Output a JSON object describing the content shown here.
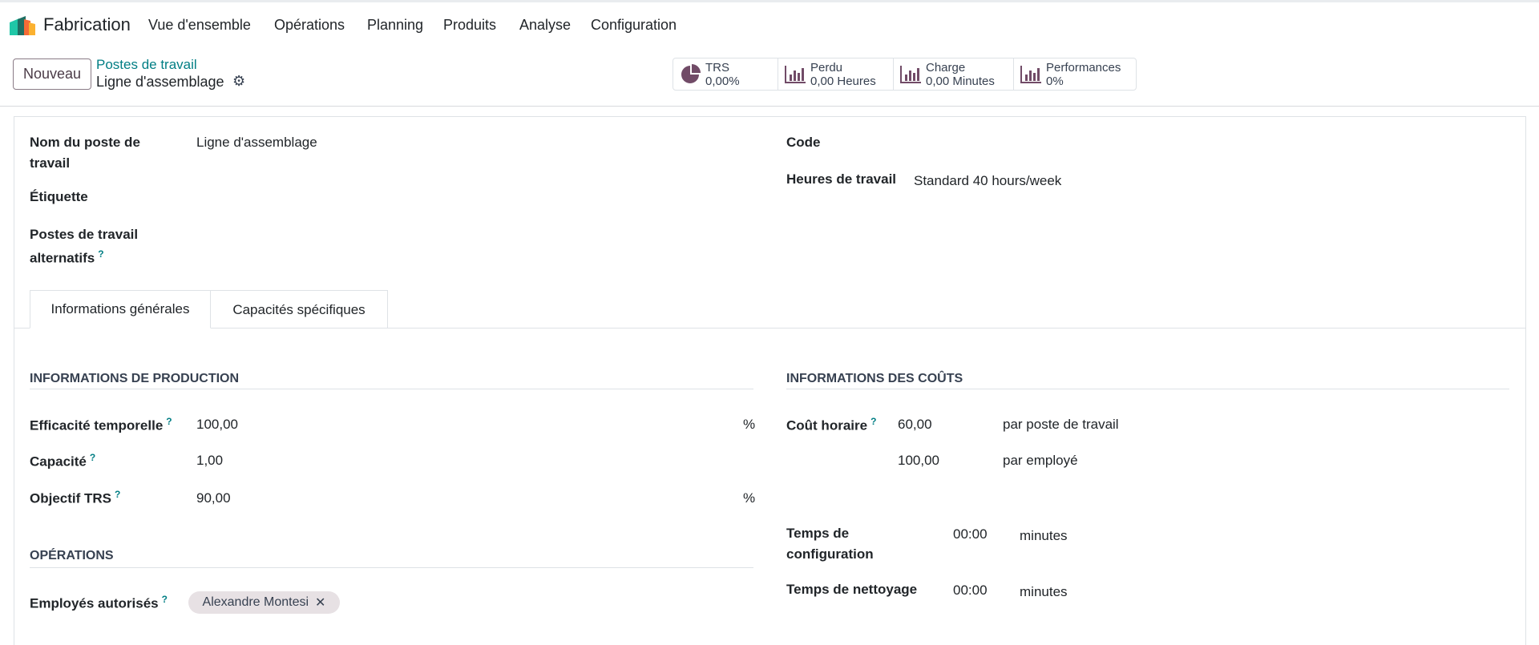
{
  "navbar": {
    "app_name": "Fabrication",
    "menu": [
      "Vue d'ensemble",
      "Opérations",
      "Planning",
      "Produits",
      "Analyse",
      "Configuration"
    ]
  },
  "control_panel": {
    "new_label": "Nouveau",
    "breadcrumb_parent": "Postes de travail",
    "breadcrumb_current": "Ligne d'assemblage"
  },
  "stats": [
    {
      "icon": "pie-chart-icon",
      "label": "TRS",
      "value": "0,00%"
    },
    {
      "icon": "bar-chart-icon",
      "label": "Perdu",
      "value": "0,00 Heures"
    },
    {
      "icon": "bar-chart-icon",
      "label": "Charge",
      "value": "0,00 Minutes"
    },
    {
      "icon": "bar-chart-icon",
      "label": "Performances",
      "value": "0%"
    }
  ],
  "form": {
    "name_label_1": "Nom du poste de",
    "name_label_2": "travail",
    "name_value": "Ligne d'assemblage",
    "tag_label": "Étiquette",
    "alt_label_1": "Postes de travail",
    "alt_label_2": "alternatifs",
    "code_label": "Code",
    "hours_label": "Heures de travail",
    "hours_value": "Standard 40 hours/week",
    "help": "?"
  },
  "tabs": [
    {
      "label": "Informations générales",
      "active": true
    },
    {
      "label": "Capacités spécifiques",
      "active": false
    }
  ],
  "production": {
    "title": "INFORMATIONS DE PRODUCTION",
    "efficiency_label": "Efficacité temporelle",
    "efficiency_value": "100,00",
    "efficiency_unit": "%",
    "capacity_label": "Capacité",
    "capacity_value": "1,00",
    "oee_label": "Objectif TRS",
    "oee_value": "90,00",
    "oee_unit": "%"
  },
  "operations": {
    "title": "OPÉRATIONS",
    "employees_label": "Employés autorisés",
    "employees": [
      "Alexandre Montesi"
    ],
    "remove": "✕"
  },
  "costs": {
    "title": "INFORMATIONS DES COÛTS",
    "hourly_label": "Coût horaire",
    "hourly_value": "60,00",
    "hourly_unit": "par poste de travail",
    "employee_value": "100,00",
    "employee_unit": "par employé",
    "setup_label_1": "Temps de",
    "setup_label_2": "configuration",
    "setup_value": "00:00",
    "setup_unit": "minutes",
    "cleanup_label": "Temps de nettoyage",
    "cleanup_value": "00:00",
    "cleanup_unit": "minutes"
  },
  "colors": {
    "accent": "#017e84",
    "primary": "#714b67"
  }
}
